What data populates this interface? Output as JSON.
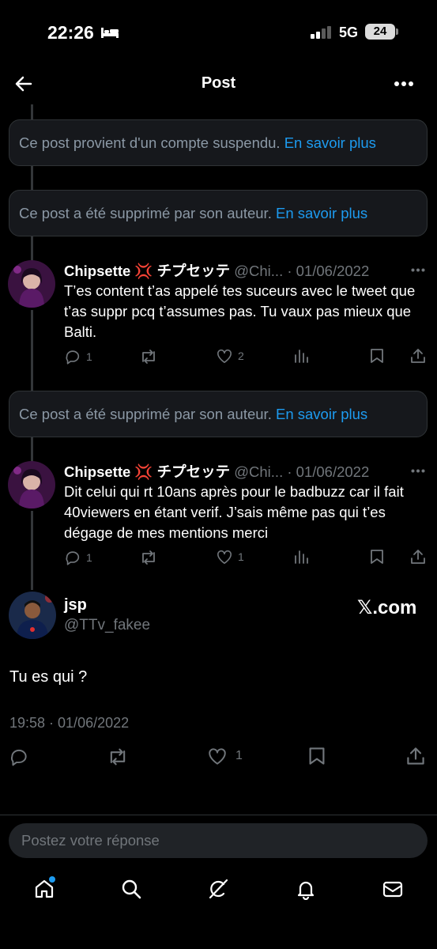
{
  "status_bar": {
    "time": "22:26",
    "network": "5G",
    "battery": "24"
  },
  "header": {
    "title": "Post"
  },
  "notices": [
    {
      "text": "Ce post provient d'un compte suspendu.",
      "link": "En savoir plus"
    },
    {
      "text": "Ce post a été supprimé par son auteur.",
      "link": "En savoir plus"
    },
    {
      "text": "Ce post a été supprimé par son auteur.",
      "link": "En savoir plus"
    }
  ],
  "replies": [
    {
      "name": "Chipsette 💢 チプセッテ",
      "handle": "@Chi...",
      "date": "· 01/06/2022",
      "text": "T’es content t’as appelé tes suceurs avec le tweet que t’as suppr pcq t’assumes pas. Tu vaux pas mieux que Balti.",
      "replies": "1",
      "likes": "2"
    },
    {
      "name": "Chipsette 💢 チプセッテ",
      "handle": "@Chi...",
      "date": "· 01/06/2022",
      "text": "Dit celui qui rt 10ans après pour le badbuzz car il fait 40viewers en étant verif. J’sais même pas qui t’es dégage de mes mentions merci",
      "replies": "1",
      "likes": "1"
    }
  ],
  "main_post": {
    "name": "jsp",
    "handle": "@TTv_fakee",
    "watermark": "𝕏.com",
    "text": "Tu es qui ?",
    "timestamp": "19:58 · 01/06/2022",
    "likes": "1"
  },
  "compose": {
    "placeholder": "Postez votre réponse"
  },
  "icons": {
    "back": "back-arrow-icon",
    "more": "more-icon",
    "reply": "reply-icon",
    "repost": "repost-icon",
    "like": "like-icon",
    "views": "views-icon",
    "bookmark": "bookmark-icon",
    "share": "share-icon",
    "home": "home-icon",
    "search": "search-icon",
    "grok": "grok-icon",
    "notifications": "bell-icon",
    "messages": "mail-icon"
  },
  "colors": {
    "accent": "#1d9bf0",
    "background": "#000000",
    "muted": "#71767b"
  }
}
